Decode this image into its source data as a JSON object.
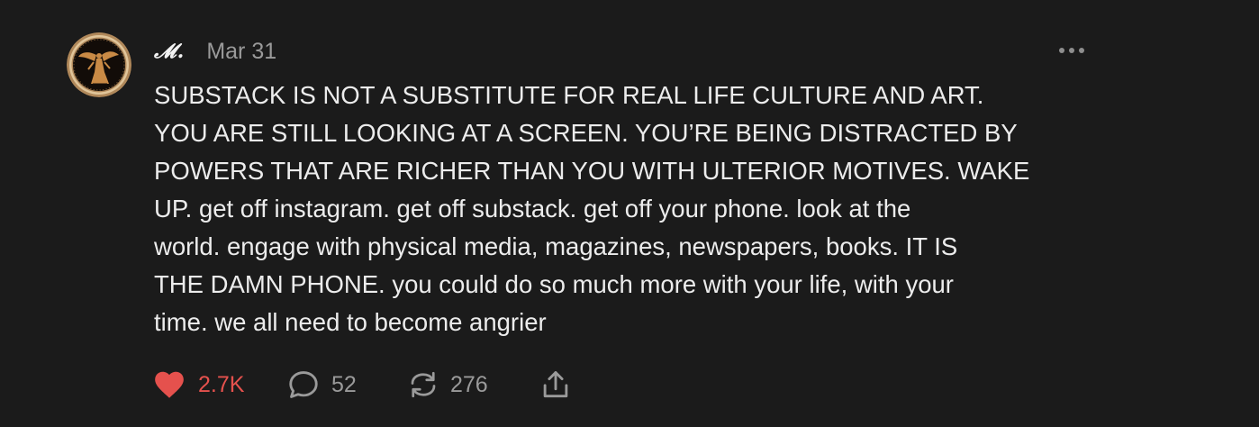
{
  "note": {
    "author": "𝓜.",
    "date": "Mar 31",
    "body": "SUBSTACK IS NOT A SUBSTITUTE FOR REAL LIFE CULTURE AND ART.\nYOU ARE STILL LOOKING AT A SCREEN. YOU’RE BEING DISTRACTED BY\nPOWERS THAT ARE RICHER THAN YOU WITH ULTERIOR MOTIVES. WAKE\nUP. get off instagram. get off substack. get off your phone. look at the\nworld. engage with physical media, magazines, newspapers, books. IT IS\nTHE DAMN PHONE. you could do so much more with your life, with your\ntime. we all need to become angrier"
  },
  "actions": {
    "like": {
      "count": "2.7K",
      "liked": true,
      "icon": "heart-icon"
    },
    "comment": {
      "count": "52",
      "icon": "comment-icon"
    },
    "restack": {
      "count": "276",
      "icon": "restack-icon"
    },
    "share": {
      "icon": "share-icon"
    }
  },
  "menu": {
    "icon": "more-icon"
  },
  "colors": {
    "background": "#1b1b1b",
    "text": "#ececec",
    "muted": "#9a9a9a",
    "like": "#e5514d"
  }
}
